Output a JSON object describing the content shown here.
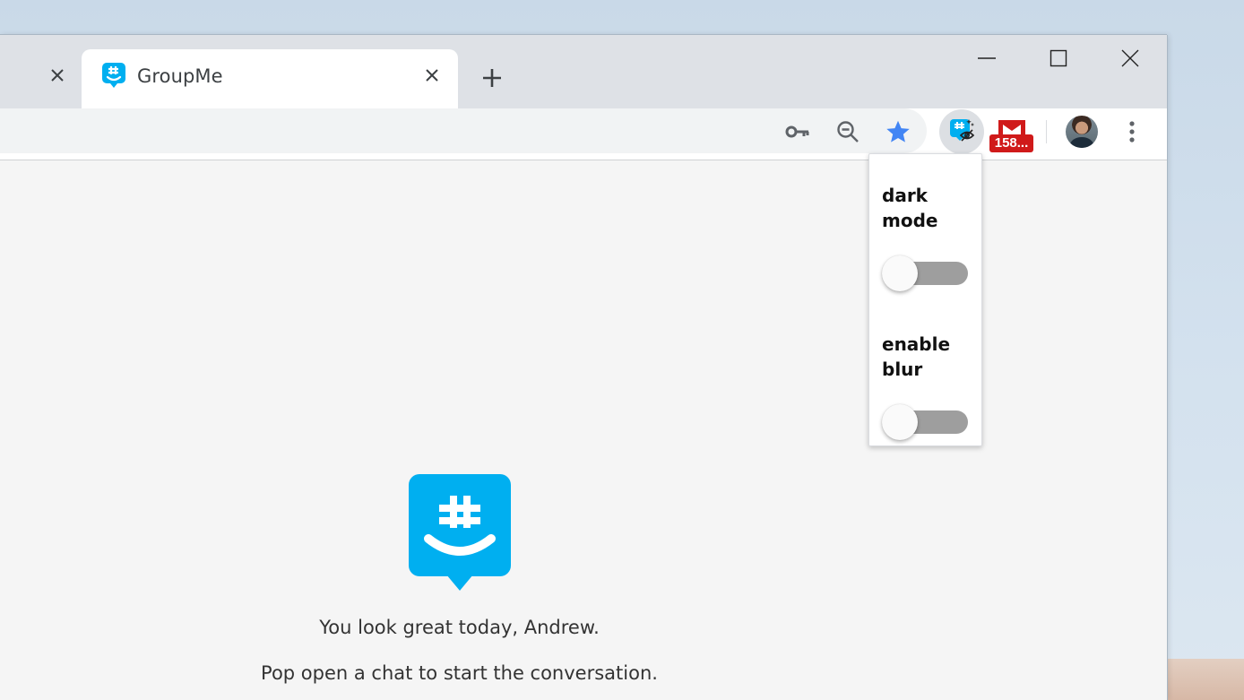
{
  "browser": {
    "active_tab": {
      "title": "GroupMe"
    },
    "new_tab_symbol": "+",
    "window_controls": [
      "minimize-icon",
      "maximize-icon",
      "close-icon"
    ],
    "toolbar_icons": [
      "key-icon",
      "zoom-out-icon",
      "star-icon",
      "groupme-extension-icon",
      "gmail-extension-icon",
      "avatar",
      "more-menu-icon"
    ]
  },
  "extensions": {
    "gmail_badge": "158..."
  },
  "extension_popup": {
    "options": [
      {
        "label": "dark mode",
        "enabled": false
      },
      {
        "label": "enable blur",
        "enabled": false
      }
    ]
  },
  "page": {
    "greeting": "You look great today, Andrew.",
    "subtext": "Pop open a chat to start the conversation."
  },
  "colors": {
    "groupme_blue": "#00aff0",
    "star_blue": "#4285f4",
    "gmail_red": "#d01a1a",
    "toggle_off": "#9e9e9e"
  }
}
